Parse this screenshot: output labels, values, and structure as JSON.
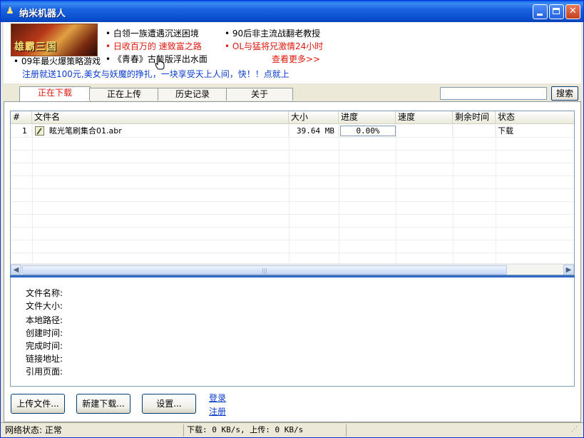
{
  "window": {
    "title": "纳米机器人"
  },
  "ads": {
    "banner_text": "雄霸三国",
    "banner_caption": "• 09年最火爆策略游戏",
    "col1": [
      "• 白领一族遭遇沉迷困境",
      "• 日收百万的   速致富之路",
      "• 《青春》古装版浮出水面"
    ],
    "col2": [
      "• 90后非主流战翻老教授",
      "• OL与猛将兄激情24小时"
    ],
    "more": "查看更多>>",
    "promo": "注册就送100元,美女与妖魔的挣扎，一块享受天上人间，快！！点就上"
  },
  "tabs": [
    {
      "label": "正在下载",
      "active": true
    },
    {
      "label": "正在上传",
      "active": false
    },
    {
      "label": "历史记录",
      "active": false
    },
    {
      "label": "关于",
      "active": false
    }
  ],
  "search": {
    "button": "搜索",
    "value": ""
  },
  "table": {
    "columns": [
      "#",
      "文件名",
      "大小",
      "进度",
      "速度",
      "剩余时间",
      "状态"
    ],
    "rows": [
      {
        "index": "1",
        "name": "眩光笔刷集合01.abr",
        "size": "39.64 MB",
        "progress": "0.00%",
        "speed": "",
        "remaining": "",
        "status": "下载"
      }
    ]
  },
  "details": {
    "labels": [
      "文件名称:",
      "文件大小:",
      "本地路径:",
      "创建时间:",
      "完成时间:",
      "链接地址:",
      "引用页面:"
    ]
  },
  "buttons": {
    "upload": "上传文件...",
    "new_download": "新建下载...",
    "settings": "设置..."
  },
  "links": {
    "login": "登录",
    "register": "注册"
  },
  "status": {
    "network": "网络状态: 正常",
    "speed": "下载: 0 KB/s, 上传: 0 KB/s"
  },
  "colors": {
    "accent_red": "#e0180c",
    "link_blue": "#0a3ccf",
    "titlebar": "#0a4fd0"
  }
}
